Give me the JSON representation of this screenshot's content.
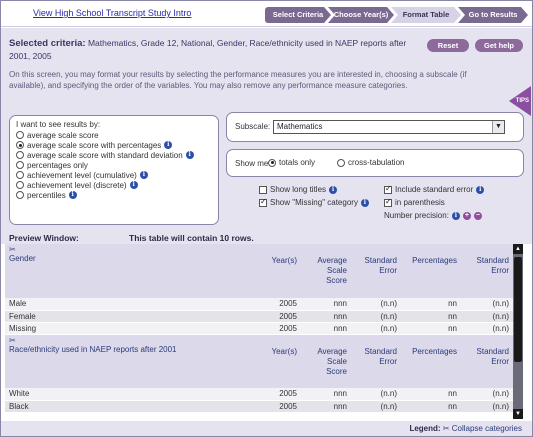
{
  "nav": {
    "intro_link": "View High School Transcript Study Intro",
    "steps": [
      "Select Criteria",
      "Choose Year(s)",
      "Format Table",
      "Go to Results"
    ]
  },
  "criteria": {
    "label": "Selected criteria:",
    "text": "Mathematics, Grade 12, National, Gender, Race/ethnicity used in NAEP reports after 2001, 2005",
    "reset_label": "Reset",
    "help_label": "Get help"
  },
  "instructions": "On this screen, you may format your results by selecting the performance measures you are interested in, choosing a subscale (if available), and specifying the order of the variables. You may also remove any performance measure categories.",
  "tips_label": "TIPS",
  "results": {
    "heading": "I want to see results by:",
    "options": [
      "average scale score",
      "average scale score with percentages",
      "average scale score with standard deviation",
      "percentages only",
      "achievement level (cumulative)",
      "achievement level (discrete)",
      "percentiles"
    ],
    "selected_index": 1
  },
  "subscale": {
    "label": "Subscale:",
    "value": "Mathematics"
  },
  "showme": {
    "label": "Show me",
    "option_totals": "totals only",
    "option_cross": "cross-tabulation",
    "selected": "totals only"
  },
  "checkboxes": {
    "long_titles": "Show long titles",
    "missing_category": "Show \"Missing\" category",
    "standard_error": "Include standard error",
    "in_parenthesis": "in parenthesis",
    "precision": "Number precision:",
    "long_titles_checked": false,
    "missing_checked": true,
    "stderr_checked": true,
    "paren_checked": true
  },
  "preview": {
    "title": "Preview Window:",
    "count": "This table will contain 10 rows."
  },
  "table": {
    "columns": [
      "Year(s)",
      "Average Scale Score",
      "Standard Error",
      "Percentages",
      "Standard Error"
    ],
    "groups": [
      {
        "variable": "Gender",
        "rows": [
          {
            "label": "Male",
            "year": "2005",
            "avg": "nnn",
            "se1": "(n.n)",
            "pct": "nn",
            "se2": "(n.n)"
          },
          {
            "label": "Female",
            "year": "2005",
            "avg": "nnn",
            "se1": "(n.n)",
            "pct": "nn",
            "se2": "(n.n)"
          },
          {
            "label": "Missing",
            "year": "2005",
            "avg": "nnn",
            "se1": "(n.n)",
            "pct": "nn",
            "se2": "(n.n)"
          }
        ]
      },
      {
        "variable": "Race/ethnicity used in NAEP reports after 2001",
        "rows": [
          {
            "label": "White",
            "year": "2005",
            "avg": "nnn",
            "se1": "(n.n)",
            "pct": "nn",
            "se2": "(n.n)"
          },
          {
            "label": "Black",
            "year": "2005",
            "avg": "nnn",
            "se1": "(n.n)",
            "pct": "nn",
            "se2": "(n.n)"
          }
        ]
      }
    ]
  },
  "legend": {
    "label": "Legend:",
    "text": "Collapse categories"
  },
  "icons": {
    "info": "info-icon",
    "collapse": "scissors-icon",
    "increase": "plus-icon",
    "decrease": "minus-icon"
  },
  "colors": {
    "panel": "#e6e3f0",
    "accent": "#8e6a9c",
    "step": "#7a6a92",
    "step_current": "#d8d2e6",
    "link": "#2a2aa8"
  }
}
